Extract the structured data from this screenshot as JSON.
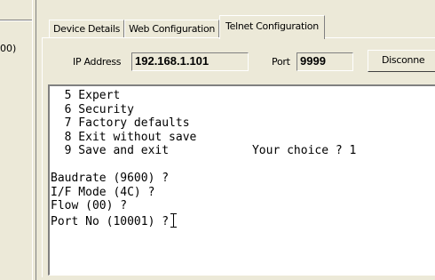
{
  "left_pane": {
    "fragment": "00)"
  },
  "tabs": [
    {
      "label": "Device Details",
      "active": false
    },
    {
      "label": "Web Configuration",
      "active": false
    },
    {
      "label": "Telnet Configuration",
      "active": true
    }
  ],
  "connection": {
    "ip_label": "IP Address",
    "ip_value": "192.168.1.101",
    "port_label": "Port",
    "port_value": "9999",
    "disconnect_label": "Disconne"
  },
  "terminal": {
    "lines": [
      "  5 Expert",
      "  6 Security",
      "  7 Factory defaults",
      "  8 Exit without save",
      "  9 Save and exit            Your choice ? 1",
      "",
      "Baudrate (9600) ?",
      "I/F Mode (4C) ?",
      "Flow (00) ?",
      "Port No (10001) ?"
    ]
  }
}
